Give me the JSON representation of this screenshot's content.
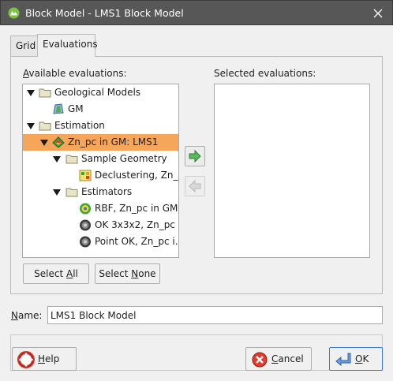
{
  "window": {
    "title": "Block Model - LMS1 Block Model",
    "icon": "app-logo-icon",
    "close_icon": "close-icon"
  },
  "tabs": [
    {
      "label": "Grid",
      "active": false
    },
    {
      "label": "Evaluations",
      "active": true
    }
  ],
  "available": {
    "label_prefix": "A",
    "label_rest": "vailable evaluations:",
    "items": [
      {
        "label": "Geological Models",
        "icon": "folder-icon",
        "expanded": true
      },
      {
        "label": "GM",
        "icon": "geological-model-icon"
      },
      {
        "label": "Estimation",
        "icon": "folder-icon",
        "expanded": true
      },
      {
        "label": "Zn_pc in GM: LMS1",
        "icon": "domained-estimation-icon",
        "expanded": true,
        "selected": true
      },
      {
        "label": "Sample Geometry",
        "icon": "folder-icon",
        "expanded": true
      },
      {
        "label": "Declustering, Zn_...",
        "icon": "declustering-icon"
      },
      {
        "label": "Estimators",
        "icon": "folder-icon",
        "expanded": true
      },
      {
        "label": "RBF, Zn_pc in GM...",
        "icon": "rbf-estimator-icon"
      },
      {
        "label": "OK 3x3x2, Zn_pc i...",
        "icon": "kriging-estimator-icon"
      },
      {
        "label": "Point OK, Zn_pc i...",
        "icon": "kriging-estimator-icon"
      }
    ]
  },
  "selected": {
    "label": "Selected evaluations:",
    "items": []
  },
  "transfer": {
    "add_icon": "arrow-right-icon",
    "remove_icon": "arrow-left-icon"
  },
  "buttons": {
    "select_all_pre": "Select ",
    "select_all_ul": "A",
    "select_all_post": "ll",
    "select_none_pre": "Select ",
    "select_none_ul": "N",
    "select_none_post": "one"
  },
  "name": {
    "label_ul": "N",
    "label_rest": "ame:",
    "value": "LMS1 Block Model"
  },
  "footer": {
    "help_ul": "H",
    "help_rest": "elp",
    "help_icon": "lifebuoy-icon",
    "cancel_ul": "C",
    "cancel_rest": "ancel",
    "cancel_icon": "cancel-icon",
    "ok_ul": "O",
    "ok_rest": "K",
    "ok_icon": "ok-enter-icon"
  },
  "colors": {
    "titlebar": "#575757",
    "selection": "#f5a65a",
    "accent_green": "#3aa63a"
  }
}
